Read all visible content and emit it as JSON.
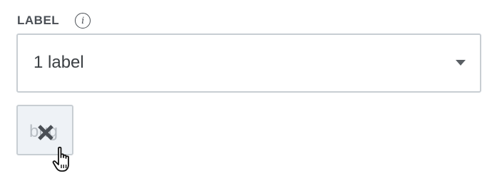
{
  "field": {
    "label": "LABEL",
    "info_icon": "info-icon",
    "info_glyph": "i"
  },
  "select": {
    "value": "1 label",
    "caret_icon": "chevron-down-icon"
  },
  "chips": [
    {
      "text": "bug",
      "remove_icon": "close-icon"
    }
  ],
  "cursor": "hand-pointer-icon",
  "colors": {
    "label_text": "#4a4f55",
    "border": "#c8ced3",
    "chip_background": "#eef2f6",
    "icon": "#4a4f55"
  }
}
